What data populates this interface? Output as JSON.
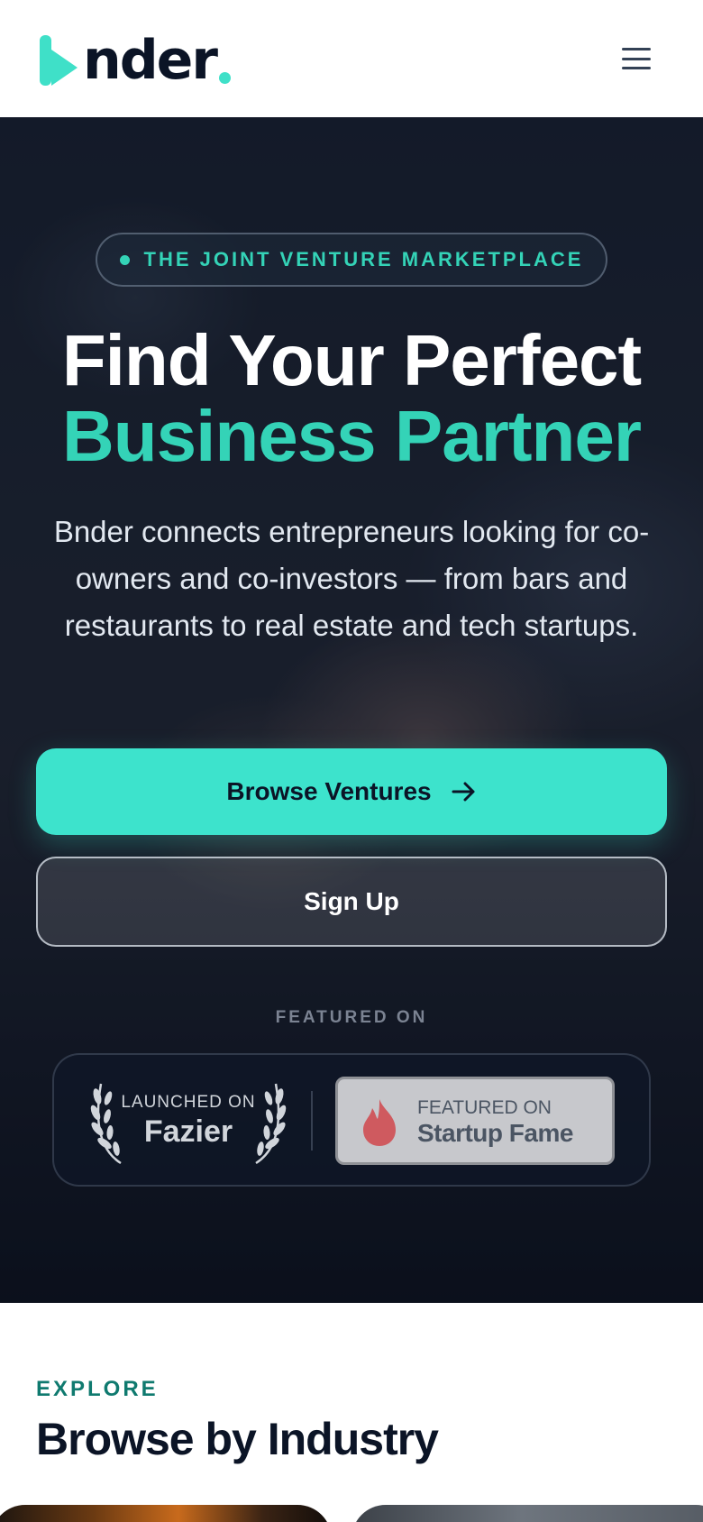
{
  "header": {
    "logo_text": "nder",
    "brand_color": "#3fe0c8",
    "menu_icon": "hamburger-menu-icon"
  },
  "hero": {
    "eyebrow": "THE JOINT VENTURE MARKETPLACE",
    "title_line1": "Find Your Perfect",
    "title_line2": "Business Partner",
    "subtitle": "Bnder connects entrepreneurs looking for co-owners and co-investors — from bars and restaurants to real estate and tech startups.",
    "primary_button": "Browse Ventures",
    "primary_button_icon": "arrow-right-icon",
    "secondary_button": "Sign Up",
    "featured_label": "FEATURED ON",
    "badges": {
      "fazier_small": "LAUNCHED ON",
      "fazier_big": "Fazier",
      "startup_fame_small": "FEATURED ON",
      "startup_fame_big": "Startup Fame"
    },
    "accent_color": "#3de3cc"
  },
  "explore": {
    "eyebrow": "EXPLORE",
    "title": "Browse by Industry"
  }
}
